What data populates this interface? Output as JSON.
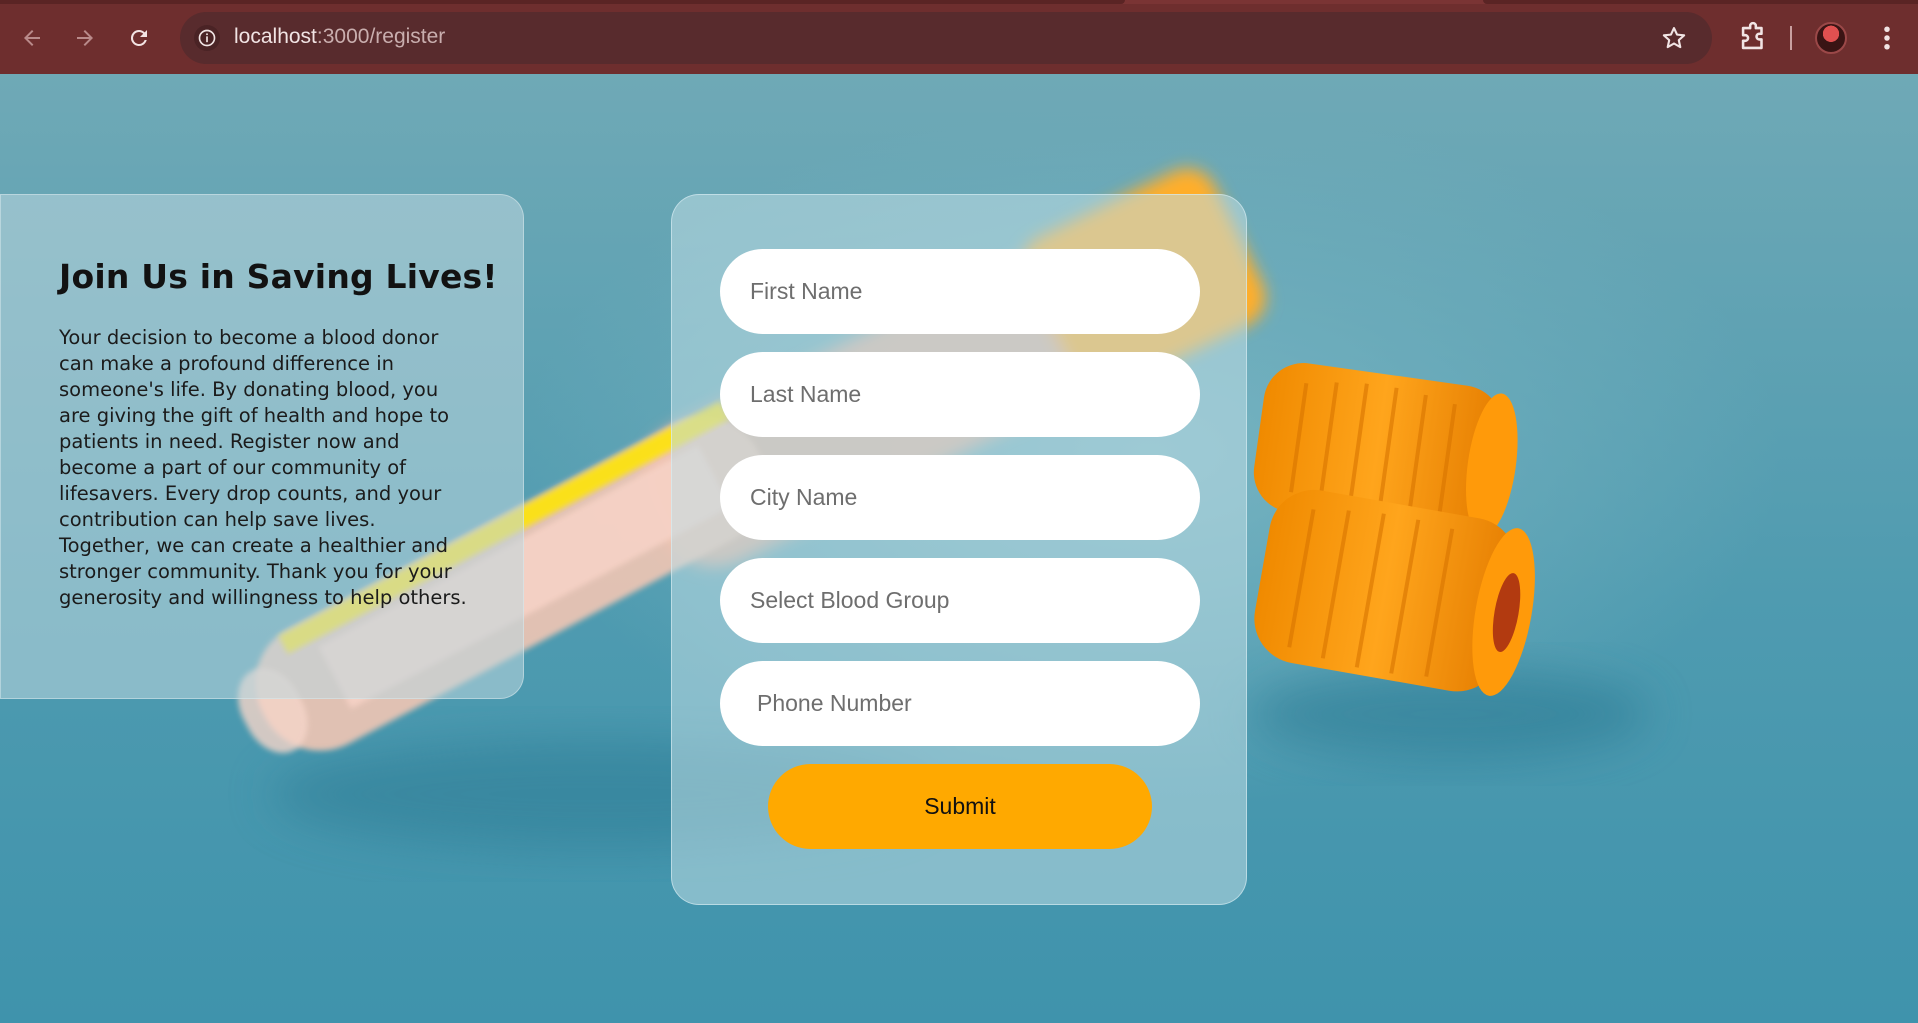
{
  "browser": {
    "url_host": "localhost",
    "url_path": ":3000/register",
    "accent": "#6e2e2e"
  },
  "icons": {
    "back": "arrow-left-icon",
    "forward": "arrow-right-icon",
    "reload": "reload-icon",
    "site_info": "info-icon",
    "bookmark": "star-icon",
    "extensions": "puzzle-icon",
    "profile": "avatar",
    "menu": "kebab-menu-icon"
  },
  "info": {
    "title": "Join Us in Saving Lives!",
    "text": "Your decision to become a blood donor can make a profound difference in someone's life. By donating blood, you are giving the gift of health and hope to patients in need. Register now and become a part of our community of lifesavers. Every drop counts, and your contribution can help save lives. Together, we can create a healthier and stronger community. Thank you for your generosity and willingness to help others."
  },
  "form": {
    "first_name_placeholder": "First Name",
    "last_name_placeholder": "Last Name",
    "city_placeholder": "City Name",
    "blood_group_placeholder": "Select Blood Group",
    "phone_placeholder": "Phone Number",
    "submit_label": "Submit",
    "submit_color": "#ffa900"
  }
}
